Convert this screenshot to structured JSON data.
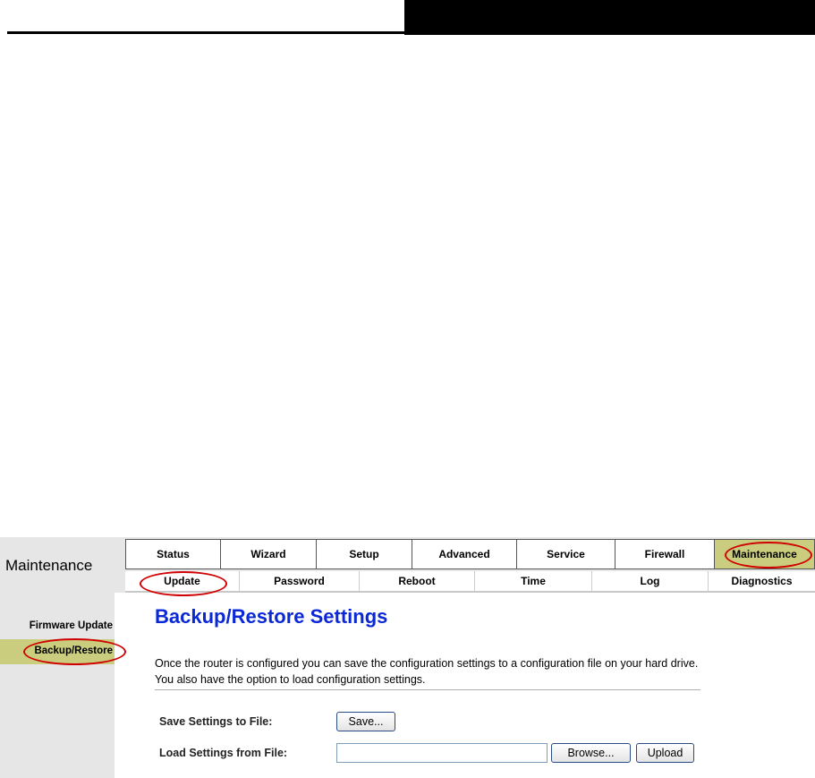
{
  "section": {
    "title": "Maintenance"
  },
  "top_nav": {
    "tabs": [
      {
        "label": "Status"
      },
      {
        "label": "Wizard"
      },
      {
        "label": "Setup"
      },
      {
        "label": "Advanced"
      },
      {
        "label": "Service"
      },
      {
        "label": "Firewall"
      },
      {
        "label": "Maintenance",
        "active": true
      }
    ]
  },
  "sub_nav": {
    "tabs": [
      {
        "label": "Update",
        "active": true
      },
      {
        "label": "Password"
      },
      {
        "label": "Reboot"
      },
      {
        "label": "Time"
      },
      {
        "label": "Log"
      },
      {
        "label": "Diagnostics"
      }
    ]
  },
  "sidebar": {
    "items": [
      {
        "label": "Firmware Update"
      },
      {
        "label": "Backup/Restore",
        "active": true
      }
    ]
  },
  "page": {
    "title": "Backup/Restore Settings",
    "description": "Once the router is configured you can save the configuration settings to a configuration file on your hard drive. You also have the option to load configuration settings."
  },
  "form": {
    "save_label": "Save Settings to File:",
    "save_button": "Save...",
    "load_label": "Load Settings from File:",
    "file_value": "",
    "browse_button": "Browse...",
    "upload_button": "Upload"
  },
  "colors": {
    "active_tab": "#c9cd7d",
    "title_blue": "#0b28d6",
    "highlight_ellipse": "#d00000",
    "panel_gray": "#e6e6e6"
  }
}
